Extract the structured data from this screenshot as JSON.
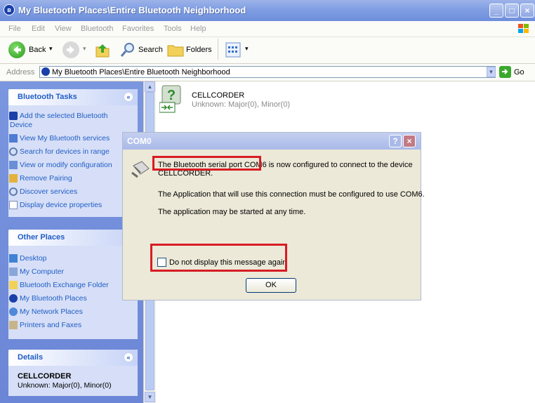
{
  "window": {
    "title": "My Bluetooth Places\\Entire Bluetooth Neighborhood"
  },
  "menu": [
    "File",
    "Edit",
    "View",
    "Bluetooth",
    "Favorites",
    "Tools",
    "Help"
  ],
  "toolbar": {
    "back": "Back",
    "search": "Search",
    "folders": "Folders"
  },
  "address": {
    "label": "Address",
    "value": "My Bluetooth Places\\Entire Bluetooth Neighborhood",
    "go": "Go"
  },
  "sidebar": {
    "bluetooth_tasks": {
      "title": "Bluetooth Tasks",
      "items": [
        "Add the selected Bluetooth",
        "Device",
        "View My Bluetooth services",
        "Search for devices in range",
        "View or modify configuration",
        "Remove Pairing",
        "Discover services",
        "Display device properties"
      ]
    },
    "other_places": {
      "title": "Other Places",
      "items": [
        "Desktop",
        "My Computer",
        "Bluetooth Exchange Folder",
        "My Bluetooth Places",
        "My Network Places",
        "Printers and Faxes"
      ]
    },
    "details": {
      "title": "Details",
      "name": "CELLCORDER",
      "info": "Unknown: Major(0), Minor(0)"
    }
  },
  "device": {
    "name": "CELLCORDER",
    "class": "Unknown: Major(0), Minor(0)"
  },
  "dialog": {
    "title": "COM0",
    "line1": "The Bluetooth serial port COM6 is now configured to connect to the device",
    "line1b": "CELLCORDER.",
    "line2": "The Application that will use this connection must be configured to use COM6.",
    "line3": "The application may be started at any time.",
    "checkbox": "Do not display this message again",
    "ok": "OK"
  },
  "colors": {
    "highlight": "#d81c24",
    "task_text": "#215dc6",
    "sidebar_bg": "#6b86d6"
  }
}
